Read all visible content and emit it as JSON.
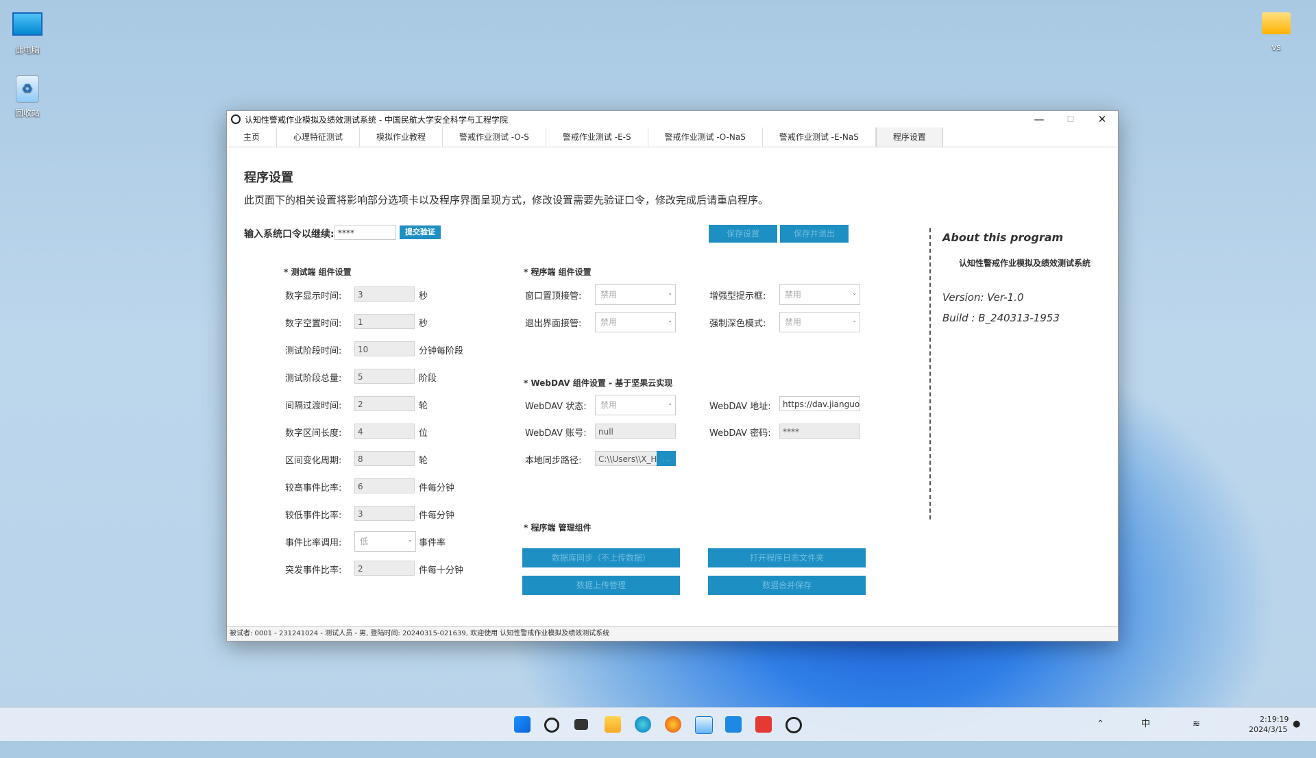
{
  "desktop": {
    "icons": [
      {
        "label": "此电脑"
      },
      {
        "label": "回收站"
      },
      {
        "label": "vs"
      }
    ]
  },
  "window": {
    "title": "认知性警戒作业模拟及绩效测试系统 - 中国民航大学安全科学与工程学院",
    "controls": {
      "minimize": "—",
      "maximize": "☐",
      "close": "✕"
    }
  },
  "tabs": [
    "主页",
    "心理特征测试",
    "模拟作业教程",
    "警戒作业测试 -O-S",
    "警戒作业测试 -E-S",
    "警戒作业测试 -O-NaS",
    "警戒作业测试 -E-NaS",
    "程序设置"
  ],
  "settings": {
    "heading": "程序设置",
    "description": "此页面下的相关设置将影响部分选项卡以及程序界面呈现方式，修改设置需要先验证口令，修改完成后请重启程序。",
    "password_label": "输入系统口令以继续:",
    "password_value": "****",
    "verify_button": "提交验证",
    "save_button": "保存设置",
    "save_exit_button": "保存并退出"
  },
  "test_section": {
    "title": "* 测试端 组件设置",
    "fields": [
      {
        "label": "数字显示时间:",
        "value": "3",
        "unit": "秒"
      },
      {
        "label": "数字空置时间:",
        "value": "1",
        "unit": "秒"
      },
      {
        "label": "测试阶段时间:",
        "value": "10",
        "unit": "分钟每阶段"
      },
      {
        "label": "测试阶段总量:",
        "value": "5",
        "unit": "阶段"
      },
      {
        "label": "间隔过渡时间:",
        "value": "2",
        "unit": "轮"
      },
      {
        "label": "数字区间长度:",
        "value": "4",
        "unit": "位"
      },
      {
        "label": "区间变化周期:",
        "value": "8",
        "unit": "轮"
      },
      {
        "label": "较高事件比率:",
        "value": "6",
        "unit": "件每分钟"
      },
      {
        "label": "较低事件比率:",
        "value": "3",
        "unit": "件每分钟"
      },
      {
        "label": "事件比率调用:",
        "value": "低",
        "unit": "事件率"
      },
      {
        "label": "突发事件比率:",
        "value": "2",
        "unit": "件每十分钟"
      }
    ]
  },
  "program_section": {
    "title": "* 程序端 组件设置",
    "topmost_label": "窗口置顶接管:",
    "topmost_value": "禁用",
    "exit_label": "退出界面接管:",
    "exit_value": "禁用",
    "tip_label": "增强型提示框:",
    "tip_value": "禁用",
    "dark_label": "强制深色模式:",
    "dark_value": "禁用"
  },
  "webdav": {
    "title": "* WebDAV 组件设置 - 基于坚果云实现",
    "status_label": "WebDAV 状态:",
    "status_value": "禁用",
    "account_label": "WebDAV 账号:",
    "account_value": "null",
    "address_label": "WebDAV 地址:",
    "address_value": "https://dav.jianguo",
    "password_label": "WebDAV 密码:",
    "password_value": "****",
    "path_label": "本地同步路径:",
    "path_value": "C:\\\\Users\\\\X_H",
    "path_button": "..."
  },
  "manage": {
    "title": "* 程序端 管理组件",
    "btn1": "数据库同步（不上传数据）",
    "btn2": "打开程序日志文件夹",
    "btn3": "数据上传管理",
    "btn4": "数据合并保存"
  },
  "about": {
    "heading": "About this program",
    "name": "认知性警戒作业模拟及绩效测试系统",
    "version": "Version:  Ver-1.0",
    "build": "Build :  B_240313-1953"
  },
  "status_bar": "被试者: 0001 - 231241024 - 测试人员 - 男, 登陆时间: 20240315-021639, 欢迎使用 认知性警戒作业模拟及绩效测试系统",
  "taskbar": {
    "ime": "中",
    "time": "2:19:19",
    "date": "2024/3/15",
    "icons": [
      "start-icon",
      "search-icon",
      "task-view-icon",
      "file-explorer-icon",
      "edge-icon",
      "firefox-icon",
      "photos-icon",
      "vscode-icon",
      "wps-icon",
      "app-icon"
    ]
  }
}
